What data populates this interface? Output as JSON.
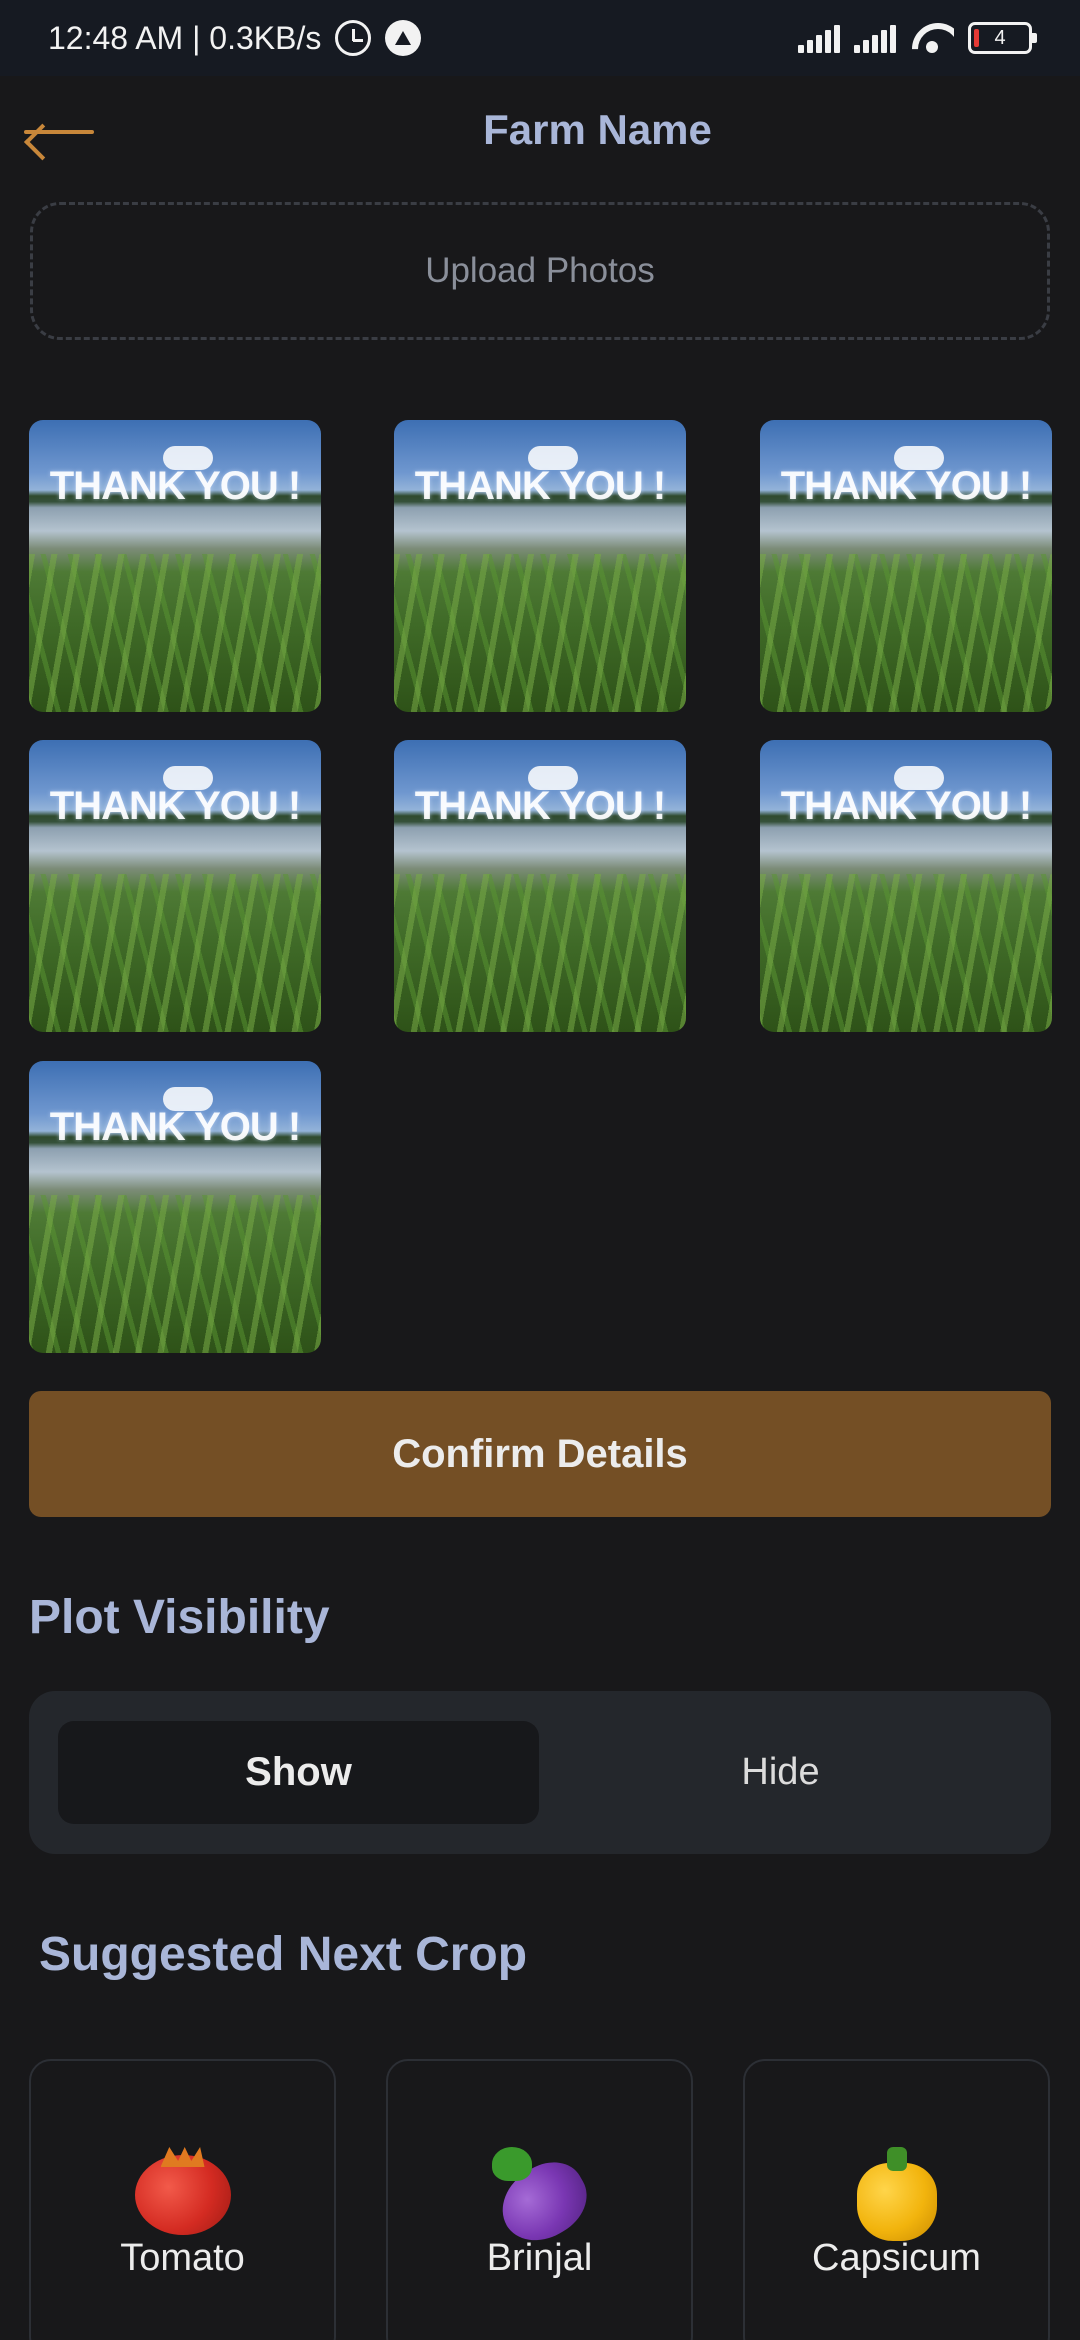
{
  "status_bar": {
    "time_and_speed": "12:48 AM | 0.3KB/s",
    "battery_level": "4"
  },
  "header": {
    "title": "Farm Name"
  },
  "upload": {
    "label": "Upload Photos"
  },
  "photos": [
    {
      "caption": "THANK YOU !"
    },
    {
      "caption": "THANK YOU !"
    },
    {
      "caption": "THANK YOU !"
    },
    {
      "caption": "THANK YOU !"
    },
    {
      "caption": "THANK YOU !"
    },
    {
      "caption": "THANK YOU !"
    },
    {
      "caption": "THANK YOU !"
    }
  ],
  "confirm": {
    "label": "Confirm Details"
  },
  "plot_visibility": {
    "title": "Plot Visibility",
    "options": [
      "Show",
      "Hide"
    ],
    "selected": "Show"
  },
  "suggested_crops": {
    "title": "Suggested Next Crop",
    "items": [
      {
        "name": "Tomato",
        "icon": "tomato-icon"
      },
      {
        "name": "Brinjal",
        "icon": "brinjal-icon"
      },
      {
        "name": "Capsicum",
        "icon": "capsicum-icon"
      }
    ]
  },
  "colors": {
    "background": "#18181a",
    "accent_title": "#a9b6d8",
    "confirm_button": "#744f25",
    "back_arrow": "#c8873a"
  }
}
